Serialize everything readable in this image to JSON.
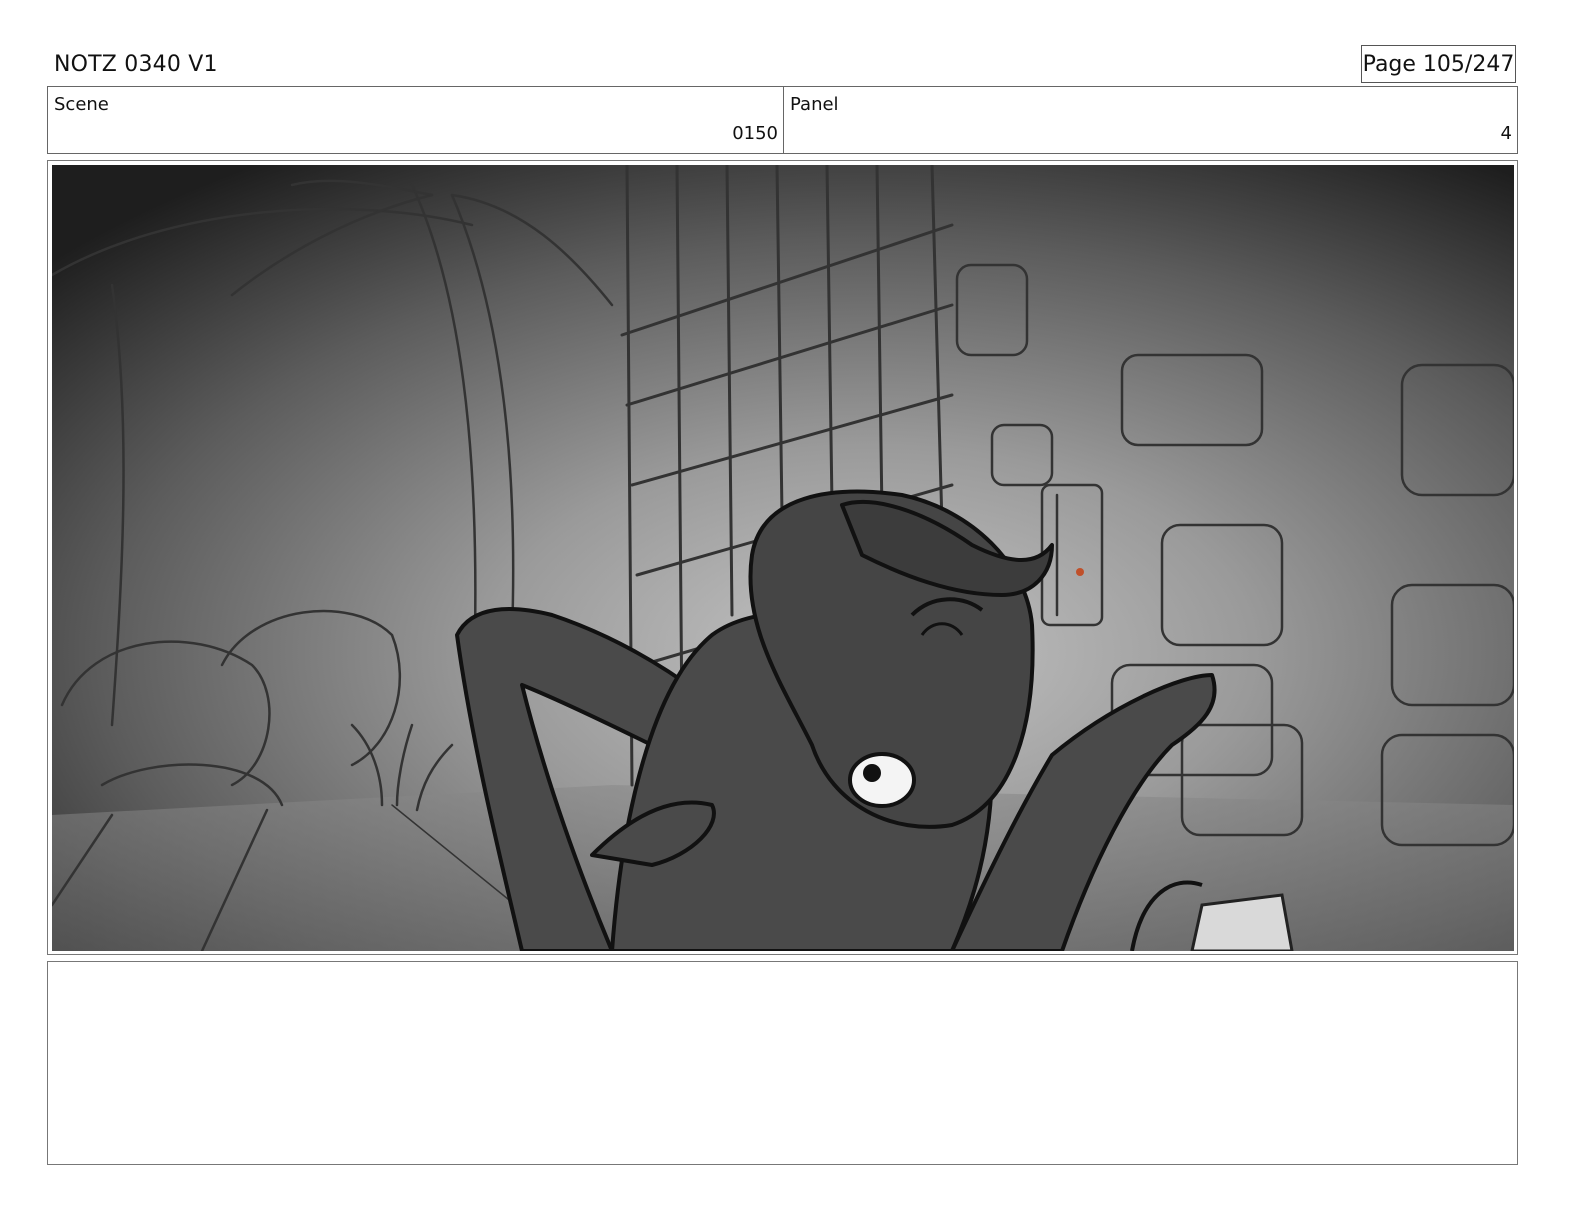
{
  "header": {
    "title": "NOTZ 0340 V1",
    "page": "Page 105/247"
  },
  "info": {
    "scene_label": "Scene",
    "scene_value": "0150",
    "panel_label": "Panel",
    "panel_value": "4"
  },
  "artwork": {
    "subject": "storyboard-sketch",
    "palette": {
      "dark": "#1a1a1a",
      "mid": "#6e6e6e",
      "light": "#bdbdbd",
      "figure": "#4a4a4a",
      "accent": "#c0502a"
    }
  },
  "notes": {
    "text": ""
  }
}
